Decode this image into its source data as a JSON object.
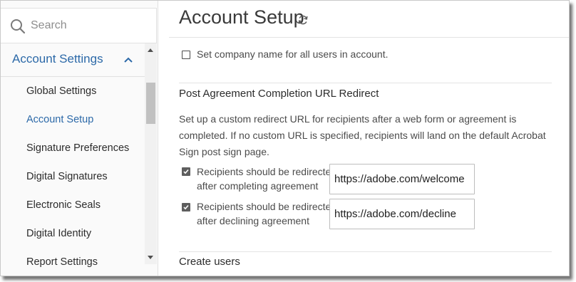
{
  "sidebar": {
    "search_label": "Search",
    "section_label": "Account Settings",
    "items": [
      {
        "label": "Global Settings",
        "active": false
      },
      {
        "label": "Account Setup",
        "active": true
      },
      {
        "label": "Signature Preferences",
        "active": false
      },
      {
        "label": "Digital Signatures",
        "active": false
      },
      {
        "label": "Electronic Seals",
        "active": false
      },
      {
        "label": "Digital Identity",
        "active": false
      },
      {
        "label": "Report Settings",
        "active": false
      }
    ]
  },
  "main": {
    "title": "Account Setup",
    "company_name_option": {
      "label": "Set company name for all users in account.",
      "checked": false
    },
    "redirect_section": {
      "title": "Post Agreement Completion URL Redirect",
      "description": "Set up a custom redirect URL for recipients after a web form or agreement is completed. If no custom URL is specified, recipients will land on the default Acrobat Sign post sign page.",
      "completing": {
        "label_line1": "Recipients should be redirected",
        "label_line2": "after completing agreement",
        "checked": true,
        "url": "https://adobe.com/welcome"
      },
      "declining": {
        "label_line1": "Recipients should be redirected",
        "label_line2": "after declining agreement",
        "checked": true,
        "url": "https://adobe.com/decline"
      }
    },
    "create_users_title": "Create users"
  },
  "colors": {
    "accent": "#2c69a8",
    "text": "#2c2c2c",
    "muted": "#8e8e8e"
  },
  "icons": {
    "search": "search-icon",
    "collapse": "chevron-up-icon",
    "refresh": "refresh-icon",
    "check": "checkmark-icon"
  }
}
